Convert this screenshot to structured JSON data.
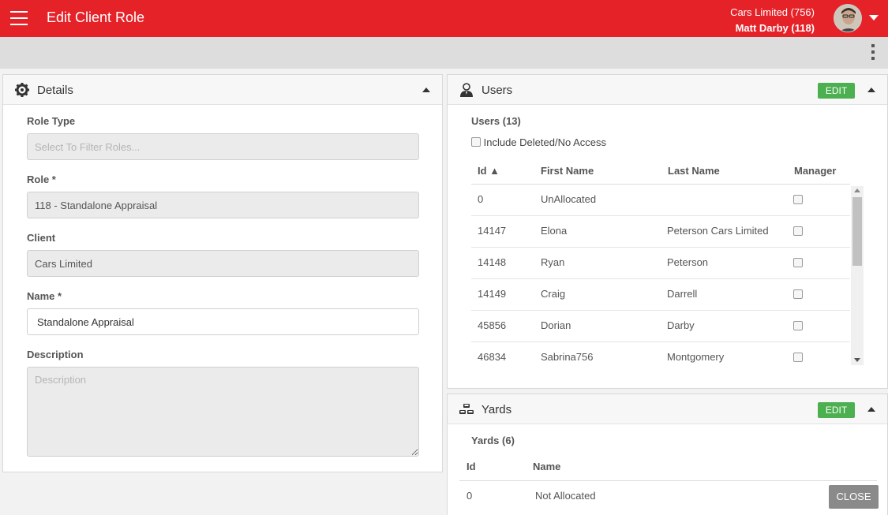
{
  "app": {
    "title": "Edit Client Role"
  },
  "account": {
    "company": "Cars Limited (756)",
    "user": "Matt Darby (118)"
  },
  "details": {
    "title": "Details",
    "role_type": {
      "label": "Role Type",
      "placeholder": "Select To Filter Roles..."
    },
    "role": {
      "label": "Role *",
      "value": "118 - Standalone Appraisal"
    },
    "client": {
      "label": "Client",
      "value": "Cars Limited"
    },
    "name": {
      "label": "Name *",
      "value": "Standalone Appraisal"
    },
    "description": {
      "label": "Description",
      "placeholder": "Description"
    }
  },
  "users": {
    "title": "Users",
    "edit_label": "EDIT",
    "count_label": "Users (13)",
    "include_deleted_label": "Include Deleted/No Access",
    "columns": {
      "id": "Id ▲",
      "first_name": "First Name",
      "last_name": "Last Name",
      "manager": "Manager"
    },
    "rows": [
      {
        "id": "0",
        "first_name": "UnAllocated",
        "last_name": ""
      },
      {
        "id": "14147",
        "first_name": "Elona",
        "last_name": "Peterson Cars Limited"
      },
      {
        "id": "14148",
        "first_name": "Ryan",
        "last_name": "Peterson"
      },
      {
        "id": "14149",
        "first_name": "Craig",
        "last_name": "Darrell"
      },
      {
        "id": "45856",
        "first_name": "Dorian",
        "last_name": "Darby"
      },
      {
        "id": "46834",
        "first_name": "Sabrina756",
        "last_name": "Montgomery"
      }
    ]
  },
  "yards": {
    "title": "Yards",
    "edit_label": "EDIT",
    "count_label": "Yards (6)",
    "columns": {
      "id": "Id",
      "name": "Name"
    },
    "rows": [
      {
        "id": "0",
        "name": "Not Allocated"
      }
    ]
  },
  "footer": {
    "close_label": "CLOSE"
  },
  "colors": {
    "brand": "#e62229",
    "edit": "#4caf50",
    "close": "#8a8a8a"
  }
}
